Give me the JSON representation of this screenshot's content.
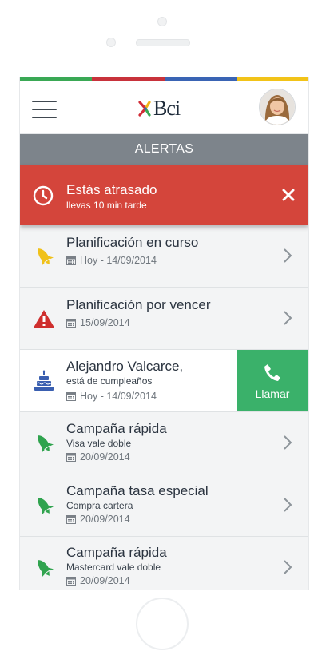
{
  "colors": {
    "stripe": [
      "#3aa855",
      "#c8323b",
      "#3a64b4",
      "#f2c318"
    ],
    "alert_red": "#d4453b",
    "section_gray": "#7d848b",
    "call_green": "#3ab16a",
    "icon_yellow": "#f0c11a",
    "icon_red": "#cf2f2e",
    "icon_green": "#2fa34e",
    "icon_blue": "#3a5fb0"
  },
  "header": {
    "logo_text": "Bci"
  },
  "section": {
    "title": "ALERTAS"
  },
  "alert": {
    "title": "Estás atrasado",
    "subtitle": "llevas 10 min tarde"
  },
  "items": [
    {
      "icon": "rocket-icon",
      "title": "Planificación en curso",
      "date": "Hoy - 14/09/2014"
    },
    {
      "icon": "warning-icon",
      "title": "Planificación por vencer",
      "date": "15/09/2014"
    },
    {
      "icon": "birthday-cake-icon",
      "title": "Alejandro Valcarce,",
      "subtitle": "está de cumpleaños",
      "date": "Hoy - 14/09/2014",
      "action_label": "Llamar"
    },
    {
      "icon": "rocket-icon",
      "title": "Campaña rápida",
      "subtitle": "Visa vale doble",
      "date": "20/09/2014"
    },
    {
      "icon": "rocket-icon",
      "title": "Campaña tasa especial",
      "subtitle": "Compra cartera",
      "date": "20/09/2014"
    },
    {
      "icon": "rocket-icon",
      "title": "Campaña rápida",
      "subtitle": "Mastercard vale doble",
      "date": "20/09/2014"
    }
  ]
}
